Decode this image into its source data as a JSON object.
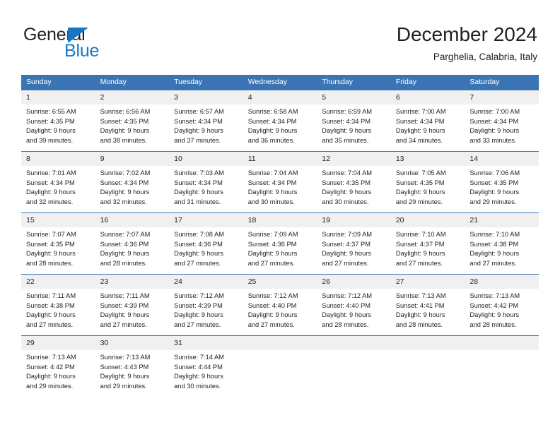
{
  "brand": {
    "name_part1": "General",
    "name_part2": "Blue",
    "triangle_color": "#1877c4",
    "text_color": "#231f20"
  },
  "header": {
    "title": "December 2024",
    "subtitle": "Parghelia, Calabria, Italy"
  },
  "theme": {
    "header_bg": "#3b74b4",
    "header_text": "#ffffff",
    "daynum_bg": "#f0f0f0",
    "cell_text": "#231f20"
  },
  "calendar": {
    "weekday_headers": [
      "Sunday",
      "Monday",
      "Tuesday",
      "Wednesday",
      "Thursday",
      "Friday",
      "Saturday"
    ],
    "weeks": [
      [
        {
          "day": "1",
          "sunrise": "Sunrise: 6:55 AM",
          "sunset": "Sunset: 4:35 PM",
          "daylight1": "Daylight: 9 hours",
          "daylight2": "and 39 minutes."
        },
        {
          "day": "2",
          "sunrise": "Sunrise: 6:56 AM",
          "sunset": "Sunset: 4:35 PM",
          "daylight1": "Daylight: 9 hours",
          "daylight2": "and 38 minutes."
        },
        {
          "day": "3",
          "sunrise": "Sunrise: 6:57 AM",
          "sunset": "Sunset: 4:34 PM",
          "daylight1": "Daylight: 9 hours",
          "daylight2": "and 37 minutes."
        },
        {
          "day": "4",
          "sunrise": "Sunrise: 6:58 AM",
          "sunset": "Sunset: 4:34 PM",
          "daylight1": "Daylight: 9 hours",
          "daylight2": "and 36 minutes."
        },
        {
          "day": "5",
          "sunrise": "Sunrise: 6:59 AM",
          "sunset": "Sunset: 4:34 PM",
          "daylight1": "Daylight: 9 hours",
          "daylight2": "and 35 minutes."
        },
        {
          "day": "6",
          "sunrise": "Sunrise: 7:00 AM",
          "sunset": "Sunset: 4:34 PM",
          "daylight1": "Daylight: 9 hours",
          "daylight2": "and 34 minutes."
        },
        {
          "day": "7",
          "sunrise": "Sunrise: 7:00 AM",
          "sunset": "Sunset: 4:34 PM",
          "daylight1": "Daylight: 9 hours",
          "daylight2": "and 33 minutes."
        }
      ],
      [
        {
          "day": "8",
          "sunrise": "Sunrise: 7:01 AM",
          "sunset": "Sunset: 4:34 PM",
          "daylight1": "Daylight: 9 hours",
          "daylight2": "and 32 minutes."
        },
        {
          "day": "9",
          "sunrise": "Sunrise: 7:02 AM",
          "sunset": "Sunset: 4:34 PM",
          "daylight1": "Daylight: 9 hours",
          "daylight2": "and 32 minutes."
        },
        {
          "day": "10",
          "sunrise": "Sunrise: 7:03 AM",
          "sunset": "Sunset: 4:34 PM",
          "daylight1": "Daylight: 9 hours",
          "daylight2": "and 31 minutes."
        },
        {
          "day": "11",
          "sunrise": "Sunrise: 7:04 AM",
          "sunset": "Sunset: 4:34 PM",
          "daylight1": "Daylight: 9 hours",
          "daylight2": "and 30 minutes."
        },
        {
          "day": "12",
          "sunrise": "Sunrise: 7:04 AM",
          "sunset": "Sunset: 4:35 PM",
          "daylight1": "Daylight: 9 hours",
          "daylight2": "and 30 minutes."
        },
        {
          "day": "13",
          "sunrise": "Sunrise: 7:05 AM",
          "sunset": "Sunset: 4:35 PM",
          "daylight1": "Daylight: 9 hours",
          "daylight2": "and 29 minutes."
        },
        {
          "day": "14",
          "sunrise": "Sunrise: 7:06 AM",
          "sunset": "Sunset: 4:35 PM",
          "daylight1": "Daylight: 9 hours",
          "daylight2": "and 29 minutes."
        }
      ],
      [
        {
          "day": "15",
          "sunrise": "Sunrise: 7:07 AM",
          "sunset": "Sunset: 4:35 PM",
          "daylight1": "Daylight: 9 hours",
          "daylight2": "and 28 minutes."
        },
        {
          "day": "16",
          "sunrise": "Sunrise: 7:07 AM",
          "sunset": "Sunset: 4:36 PM",
          "daylight1": "Daylight: 9 hours",
          "daylight2": "and 28 minutes."
        },
        {
          "day": "17",
          "sunrise": "Sunrise: 7:08 AM",
          "sunset": "Sunset: 4:36 PM",
          "daylight1": "Daylight: 9 hours",
          "daylight2": "and 27 minutes."
        },
        {
          "day": "18",
          "sunrise": "Sunrise: 7:09 AM",
          "sunset": "Sunset: 4:36 PM",
          "daylight1": "Daylight: 9 hours",
          "daylight2": "and 27 minutes."
        },
        {
          "day": "19",
          "sunrise": "Sunrise: 7:09 AM",
          "sunset": "Sunset: 4:37 PM",
          "daylight1": "Daylight: 9 hours",
          "daylight2": "and 27 minutes."
        },
        {
          "day": "20",
          "sunrise": "Sunrise: 7:10 AM",
          "sunset": "Sunset: 4:37 PM",
          "daylight1": "Daylight: 9 hours",
          "daylight2": "and 27 minutes."
        },
        {
          "day": "21",
          "sunrise": "Sunrise: 7:10 AM",
          "sunset": "Sunset: 4:38 PM",
          "daylight1": "Daylight: 9 hours",
          "daylight2": "and 27 minutes."
        }
      ],
      [
        {
          "day": "22",
          "sunrise": "Sunrise: 7:11 AM",
          "sunset": "Sunset: 4:38 PM",
          "daylight1": "Daylight: 9 hours",
          "daylight2": "and 27 minutes."
        },
        {
          "day": "23",
          "sunrise": "Sunrise: 7:11 AM",
          "sunset": "Sunset: 4:39 PM",
          "daylight1": "Daylight: 9 hours",
          "daylight2": "and 27 minutes."
        },
        {
          "day": "24",
          "sunrise": "Sunrise: 7:12 AM",
          "sunset": "Sunset: 4:39 PM",
          "daylight1": "Daylight: 9 hours",
          "daylight2": "and 27 minutes."
        },
        {
          "day": "25",
          "sunrise": "Sunrise: 7:12 AM",
          "sunset": "Sunset: 4:40 PM",
          "daylight1": "Daylight: 9 hours",
          "daylight2": "and 27 minutes."
        },
        {
          "day": "26",
          "sunrise": "Sunrise: 7:12 AM",
          "sunset": "Sunset: 4:40 PM",
          "daylight1": "Daylight: 9 hours",
          "daylight2": "and 28 minutes."
        },
        {
          "day": "27",
          "sunrise": "Sunrise: 7:13 AM",
          "sunset": "Sunset: 4:41 PM",
          "daylight1": "Daylight: 9 hours",
          "daylight2": "and 28 minutes."
        },
        {
          "day": "28",
          "sunrise": "Sunrise: 7:13 AM",
          "sunset": "Sunset: 4:42 PM",
          "daylight1": "Daylight: 9 hours",
          "daylight2": "and 28 minutes."
        }
      ],
      [
        {
          "day": "29",
          "sunrise": "Sunrise: 7:13 AM",
          "sunset": "Sunset: 4:42 PM",
          "daylight1": "Daylight: 9 hours",
          "daylight2": "and 29 minutes."
        },
        {
          "day": "30",
          "sunrise": "Sunrise: 7:13 AM",
          "sunset": "Sunset: 4:43 PM",
          "daylight1": "Daylight: 9 hours",
          "daylight2": "and 29 minutes."
        },
        {
          "day": "31",
          "sunrise": "Sunrise: 7:14 AM",
          "sunset": "Sunset: 4:44 PM",
          "daylight1": "Daylight: 9 hours",
          "daylight2": "and 30 minutes."
        },
        {
          "day": "",
          "sunrise": "",
          "sunset": "",
          "daylight1": "",
          "daylight2": ""
        },
        {
          "day": "",
          "sunrise": "",
          "sunset": "",
          "daylight1": "",
          "daylight2": ""
        },
        {
          "day": "",
          "sunrise": "",
          "sunset": "",
          "daylight1": "",
          "daylight2": ""
        },
        {
          "day": "",
          "sunrise": "",
          "sunset": "",
          "daylight1": "",
          "daylight2": ""
        }
      ]
    ]
  }
}
